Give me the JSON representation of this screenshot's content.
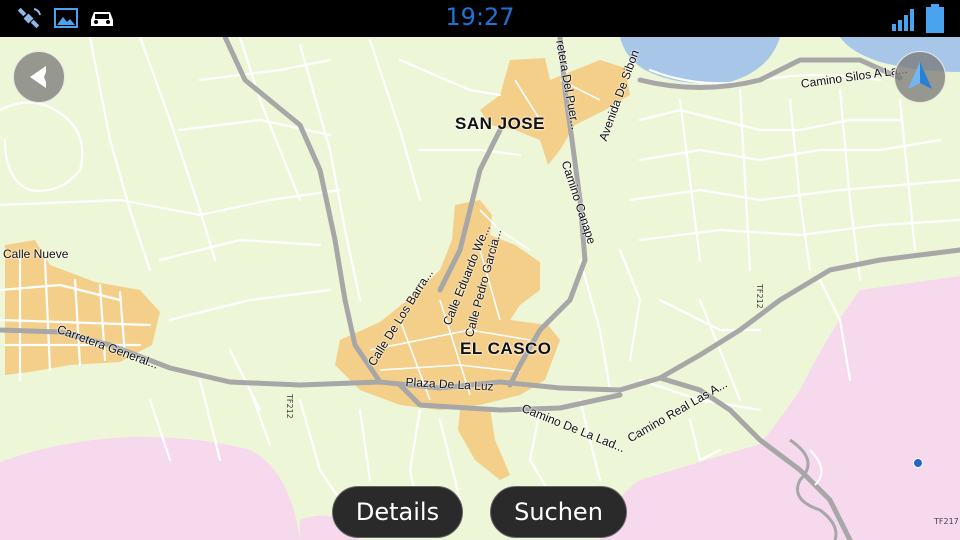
{
  "status_bar": {
    "clock": "19:27",
    "icons": [
      "satellite-icon",
      "image-icon",
      "car-icon",
      "signal-icon",
      "battery-icon"
    ],
    "clock_color": "#1e73d8"
  },
  "map": {
    "place_names": {
      "san_jose": "SAN JOSE",
      "el_casco": "EL CASCO"
    },
    "roads": {
      "calle_nueve": "Calle Nueve",
      "carretera_general": "Carretera General...",
      "calle_los_barra": "Calle De Los Barra...",
      "calle_eduardo": "Calle Eduardo We...",
      "calle_pedro": "Calle Pedro Garcia...",
      "plaza_luz": "Plaza De La Luz",
      "camino_ladera": "Camino De La Lad...",
      "camino_real": "Camino Real Las A...",
      "camino_canape": "Camino Canape",
      "carretera_puerto": "retera Del Puer...",
      "avenida_siboney": "Avenida De Sibon",
      "camino_silos": "Camino Silos A La..."
    },
    "road_codes": {
      "tf212_left": "TF212",
      "tf212_right": "TF212",
      "tf217": "TF217"
    },
    "colors": {
      "land": "#eef6d8",
      "urban": "#f3cf8a",
      "water": "#a8c7e8",
      "restricted": "#f7d9ee",
      "main_road": "#a7a7a7",
      "minor_road": "#ffffff"
    }
  },
  "controls": {
    "back_button": "back-arrow-icon",
    "compass_button": "navigation-arrow-icon",
    "details_label": "Details",
    "search_label": "Suchen"
  }
}
